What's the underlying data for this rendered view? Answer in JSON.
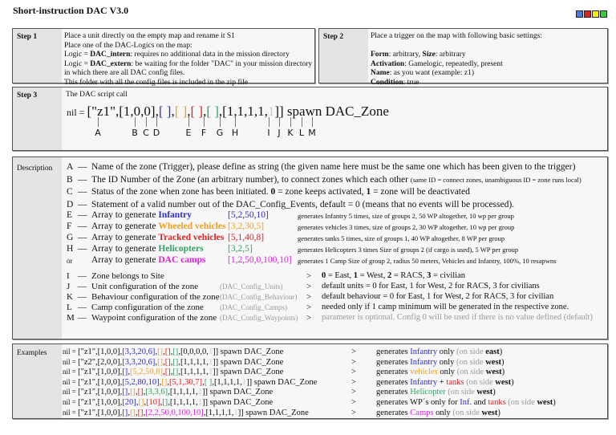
{
  "title": "Short-instruction DAC V3.0",
  "colors": {
    "blue": "#2a2ad8",
    "orange": "#f0a020",
    "red": "#e02020",
    "green": "#30a060",
    "magenta": "#e020e0",
    "gray": "#999999",
    "light": "#cccccc",
    "flag_blue": "#4a7ae8",
    "flag_red": "#e02020",
    "flag_yellow": "#f0f000",
    "flag_green": "#30d030"
  },
  "step1": {
    "label": "Step 1",
    "lines": [
      [
        [
          "Place a unit directly on the empty map and rename it S1",
          ""
        ]
      ],
      [
        [
          "Place one of the DAC-Logics on the map:",
          ""
        ]
      ],
      [
        [
          "Logic = ",
          ""
        ],
        [
          "DAC_intern",
          "b"
        ],
        [
          ": requires no additional data in the mission directory",
          ""
        ]
      ],
      [
        [
          "Logic = ",
          ""
        ],
        [
          "DAC_extern",
          "b"
        ],
        [
          ": be waiting for the folder \"DAC\" in your mission directory",
          ""
        ]
      ],
      [
        [
          "in which there are all DAC config files.",
          ""
        ]
      ],
      [
        [
          "This folder with all the config files is included in the zip file",
          ""
        ]
      ]
    ]
  },
  "step2": {
    "label": "Step 2",
    "lines": [
      [
        [
          "Place a trigger on the map with following basic settings:",
          ""
        ]
      ],
      [
        [
          " ",
          ""
        ]
      ],
      [
        [
          "Form",
          "b"
        ],
        [
          ": arbitrary,   ",
          ""
        ],
        [
          "Size",
          "b"
        ],
        [
          ": arbitrary",
          ""
        ]
      ],
      [
        [
          "Activation",
          "b"
        ],
        [
          ": Gamelogic, repeatedly, present",
          ""
        ]
      ],
      [
        [
          "Name",
          "b"
        ],
        [
          ": as you want (example: z1)",
          ""
        ]
      ],
      [
        [
          "Condition",
          "b"
        ],
        [
          ": true",
          ""
        ]
      ]
    ]
  },
  "step3": {
    "label": "Step 3",
    "subtitle": "The DAC script call",
    "code": [
      [
        "nil = ",
        "nil"
      ],
      [
        "[\"z1\",[1,0,0],",
        ""
      ],
      [
        "[ ]",
        "blue"
      ],
      [
        ",",
        ""
      ],
      [
        "[ ]",
        "orange"
      ],
      [
        ",",
        ""
      ],
      [
        "[ ]",
        "red"
      ],
      [
        ",",
        ""
      ],
      [
        "[ ]",
        "green"
      ],
      [
        ",[1,1,1,1,",
        ""
      ],
      [
        "1",
        "light"
      ],
      [
        "]] spawn DAC_Zone",
        ""
      ]
    ],
    "letters": [
      "A",
      "B",
      "C",
      "D",
      "E",
      "F",
      "G",
      "H",
      "I",
      "J",
      "K",
      "L",
      "M"
    ]
  },
  "description": {
    "label": "Description",
    "basic": [
      {
        "key": "A",
        "text": [
          [
            "Name of the zone (Trigger), please define as string (the given name here must be the same one  which has been given to the trigger)",
            ""
          ]
        ]
      },
      {
        "key": "B",
        "text": [
          [
            "The ID Number of the Zone (an arbitrary number), to connect zones which each other ",
            ""
          ],
          [
            "(same ID = connect zones, unambiguous ID = zone runs local)",
            "sm"
          ]
        ]
      },
      {
        "key": "C",
        "text": [
          [
            "Status of the zone when zone has been initiated. ",
            ""
          ],
          [
            "0",
            "b"
          ],
          [
            " = zone keeps activated, ",
            ""
          ],
          [
            "1",
            "b"
          ],
          [
            " = zone will be deactivated",
            ""
          ]
        ]
      },
      {
        "key": "D",
        "text": [
          [
            "Statement of a valid number out of the DAC_Config_Events, default = 0 (means that no events will be processed).",
            ""
          ]
        ]
      }
    ],
    "arrays": [
      {
        "key": "E",
        "dash": "—",
        "prefix": "Array to generate ",
        "name": "Infantry",
        "color": "blue",
        "value": "[5,2,50,10]",
        "note": "generates Infantry 5 times,  size of groups 2, 50 WP altogether, 10 wp per group"
      },
      {
        "key": "F",
        "dash": "—",
        "prefix": "Array to generate ",
        "name": "Wheeled vehicles",
        "color": "orange",
        "value": "[3,2,30,5]",
        "note": "generates vehicles 3 times, size of groups 2, 30 WP altogether, 10 wp per group"
      },
      {
        "key": "G",
        "dash": "—",
        "prefix": "Array to generate ",
        "name": "Tracked vehicles",
        "color": "red",
        "value": "[5,1,40,8]",
        "note": "generates tanks 5 times, size of groups 1, 40 WP altogether, 8 WP per group"
      },
      {
        "key": "H",
        "dash": "—",
        "prefix": "Array to generate ",
        "name": "Helicopters",
        "color": "green",
        "value": "[3,2,5]",
        "note": "generates Helicopters 3 times Size of groups 2 (if cargo is used), 5 WP per group"
      },
      {
        "key": "or",
        "dash": "",
        "prefix": "Array to generate ",
        "name": "DAC camps",
        "color": "magenta",
        "value": "[1,2,50,0,100,10]",
        "note": "generates 1 Camp Size of group 2, radius 50 meters, Vehicles and Infantry, 100%, 10 resapwns"
      }
    ],
    "configs": [
      {
        "key": "I",
        "label": "Zone belongs to Site",
        "cfg": "",
        "arrow": ">",
        "expl": [
          [
            "0",
            "b"
          ],
          [
            " = East, ",
            ""
          ],
          [
            "1",
            "b"
          ],
          [
            " = West, ",
            ""
          ],
          [
            "2",
            "b"
          ],
          [
            " = RACS, ",
            ""
          ],
          [
            "3",
            "b"
          ],
          [
            " = civilian",
            ""
          ]
        ]
      },
      {
        "key": "J",
        "label": "Unit configuration of the zone",
        "cfg": "(DAC_Config_Units)",
        "arrow": ">",
        "expl": [
          [
            "default units = 0 for East, 1 for West, 2 for RACS, 3 for civilians",
            ""
          ]
        ]
      },
      {
        "key": "K",
        "label": "Behaviour configuration of the zone",
        "cfg": "(DAC_Config_Behaviour)",
        "arrow": ">",
        "expl": [
          [
            "default behaviour = 0 for East, 1 for West, 2 for RACS, 3 for civilian",
            ""
          ]
        ]
      },
      {
        "key": "L",
        "label": "Camp configuration of the zone",
        "cfg": "(DAC_Config_Camps)",
        "arrow": ">",
        "expl": [
          [
            "needed only if 1 camp minimum will be generated in the respective zone.",
            ""
          ]
        ]
      },
      {
        "key": "M",
        "label": "Waypoint configuration of the zone",
        "cfg": "(DAC_Config_Waypoints)",
        "arrow": ">",
        "expl": [
          [
            "parameter is optional. Config 0 will be used if there is no value defined (default)",
            "gray"
          ]
        ]
      }
    ]
  },
  "examples": {
    "label": "Examples",
    "rows": [
      {
        "code": [
          [
            "nil = ",
            "nil"
          ],
          [
            "[\"z1\",[1,0,0],",
            ""
          ],
          [
            "[3,3,20,6]",
            "blue"
          ],
          [
            ",",
            ""
          ],
          [
            "[]",
            "orange"
          ],
          [
            ",",
            ""
          ],
          [
            "[]",
            "red"
          ],
          [
            ",",
            ""
          ],
          [
            "[]",
            "green"
          ],
          [
            ",[0,0,0,0,",
            ""
          ],
          [
            "1",
            "light"
          ],
          [
            "]] spawn DAC_Zone",
            ""
          ]
        ],
        "result": [
          [
            "generates ",
            ""
          ],
          [
            "Infantry",
            "blue"
          ],
          [
            " only ",
            ""
          ],
          [
            "(on side ",
            "gray"
          ],
          [
            "east",
            "b"
          ],
          [
            ")",
            ""
          ]
        ]
      },
      {
        "code": [
          [
            "nil = ",
            "nil"
          ],
          [
            "[\"z2\",[2,0,0],",
            ""
          ],
          [
            "[3,3,20,6]",
            "blue"
          ],
          [
            ",",
            ""
          ],
          [
            "[]",
            "orange"
          ],
          [
            ",",
            ""
          ],
          [
            "[]",
            "red"
          ],
          [
            ",",
            ""
          ],
          [
            "[]",
            "green"
          ],
          [
            ",[1,1,1,1,",
            ""
          ],
          [
            "1",
            "light"
          ],
          [
            "]] spawn DAC_Zone",
            ""
          ]
        ],
        "result": [
          [
            "generates ",
            ""
          ],
          [
            "Infantry",
            "blue"
          ],
          [
            " only ",
            ""
          ],
          [
            "(on side ",
            "gray"
          ],
          [
            "west",
            "b"
          ],
          [
            ")",
            ""
          ]
        ]
      },
      {
        "code": [
          [
            "nil = ",
            "nil"
          ],
          [
            "[\"z1\",[1,0,0],",
            ""
          ],
          [
            "[]",
            "blue"
          ],
          [
            ",",
            ""
          ],
          [
            "[5,2,50,8]",
            "orange"
          ],
          [
            ",",
            ""
          ],
          [
            "[]",
            "red"
          ],
          [
            ",",
            ""
          ],
          [
            "[]",
            "green"
          ],
          [
            ",[1,1,1,1,",
            ""
          ],
          [
            "1",
            "light"
          ],
          [
            "]] spawn DAC_Zone",
            ""
          ]
        ],
        "result": [
          [
            "generates ",
            ""
          ],
          [
            "vehicles",
            "orange"
          ],
          [
            " only ",
            ""
          ],
          [
            "(on side ",
            "gray"
          ],
          [
            "west",
            "b"
          ],
          [
            ")",
            ""
          ]
        ]
      },
      {
        "code": [
          [
            "nil = ",
            "nil"
          ],
          [
            "[\"z1\",[1,0,0],",
            ""
          ],
          [
            "[5,2,80,10]",
            "blue"
          ],
          [
            ",",
            ""
          ],
          [
            "[]",
            "orange"
          ],
          [
            ",",
            ""
          ],
          [
            "[5,1,30,7]",
            "red"
          ],
          [
            ",",
            ""
          ],
          [
            "[ ]",
            "green"
          ],
          [
            ",[1,1,1,1,",
            ""
          ],
          [
            "1",
            "light"
          ],
          [
            "]] spawn DAC_Zone",
            ""
          ]
        ],
        "result": [
          [
            "generates ",
            ""
          ],
          [
            "Infantry",
            "blue"
          ],
          [
            " + ",
            ""
          ],
          [
            "tanks",
            "red"
          ],
          [
            " (on side ",
            "gray"
          ],
          [
            "west",
            "b"
          ],
          [
            ")",
            ""
          ]
        ]
      },
      {
        "code": [
          [
            "nil = ",
            "nil"
          ],
          [
            "[\"z1\",[1,0,0],",
            ""
          ],
          [
            "[]",
            "blue"
          ],
          [
            ",",
            ""
          ],
          [
            "[]",
            "orange"
          ],
          [
            ",",
            ""
          ],
          [
            "[]",
            "red"
          ],
          [
            ",",
            ""
          ],
          [
            "[3,3,6]",
            "green"
          ],
          [
            ",[1,1,1,1,",
            ""
          ],
          [
            "1",
            "light"
          ],
          [
            "]] spawn DAC_Zone",
            ""
          ]
        ],
        "result": [
          [
            "generates ",
            ""
          ],
          [
            "Helicopter",
            "green"
          ],
          [
            " (on side ",
            "gray"
          ],
          [
            "west",
            "b"
          ],
          [
            ")",
            ""
          ]
        ]
      },
      {
        "code": [
          [
            "nil = ",
            "nil"
          ],
          [
            "[\"z1\",[1,0,0],",
            ""
          ],
          [
            "[20]",
            "blue"
          ],
          [
            ",",
            ""
          ],
          [
            "[]",
            "orange"
          ],
          [
            ",",
            ""
          ],
          [
            "[10]",
            "red"
          ],
          [
            ",",
            ""
          ],
          [
            "[]",
            "green"
          ],
          [
            ",[1,1,1,1,",
            ""
          ],
          [
            "1",
            "light"
          ],
          [
            "]] spawn DAC_Zone",
            ""
          ]
        ],
        "result": [
          [
            "generates WP´s only for ",
            ""
          ],
          [
            "Inf.",
            "blue"
          ],
          [
            " and ",
            ""
          ],
          [
            "tanks",
            "red"
          ],
          [
            " (on side ",
            "gray"
          ],
          [
            "west",
            "b"
          ],
          [
            ")",
            ""
          ]
        ]
      },
      {
        "code": [
          [
            "nil = ",
            "nil"
          ],
          [
            "[\"z1\",[1,0,0],",
            ""
          ],
          [
            "[]",
            "blue"
          ],
          [
            ",",
            ""
          ],
          [
            "[]",
            "orange"
          ],
          [
            ",",
            ""
          ],
          [
            "[]",
            "red"
          ],
          [
            ",",
            ""
          ],
          [
            "[2,2,50,0,100,10]",
            "magenta"
          ],
          [
            ",[1,1,1,1,",
            ""
          ],
          [
            "1",
            "light"
          ],
          [
            "]] spawn DAC_Zone",
            ""
          ]
        ],
        "result": [
          [
            "generates ",
            ""
          ],
          [
            "Camps",
            "magenta"
          ],
          [
            " only ",
            ""
          ],
          [
            "(on side ",
            "gray"
          ],
          [
            "west",
            "b"
          ],
          [
            ")",
            ""
          ]
        ]
      }
    ],
    "arrow": ">"
  }
}
